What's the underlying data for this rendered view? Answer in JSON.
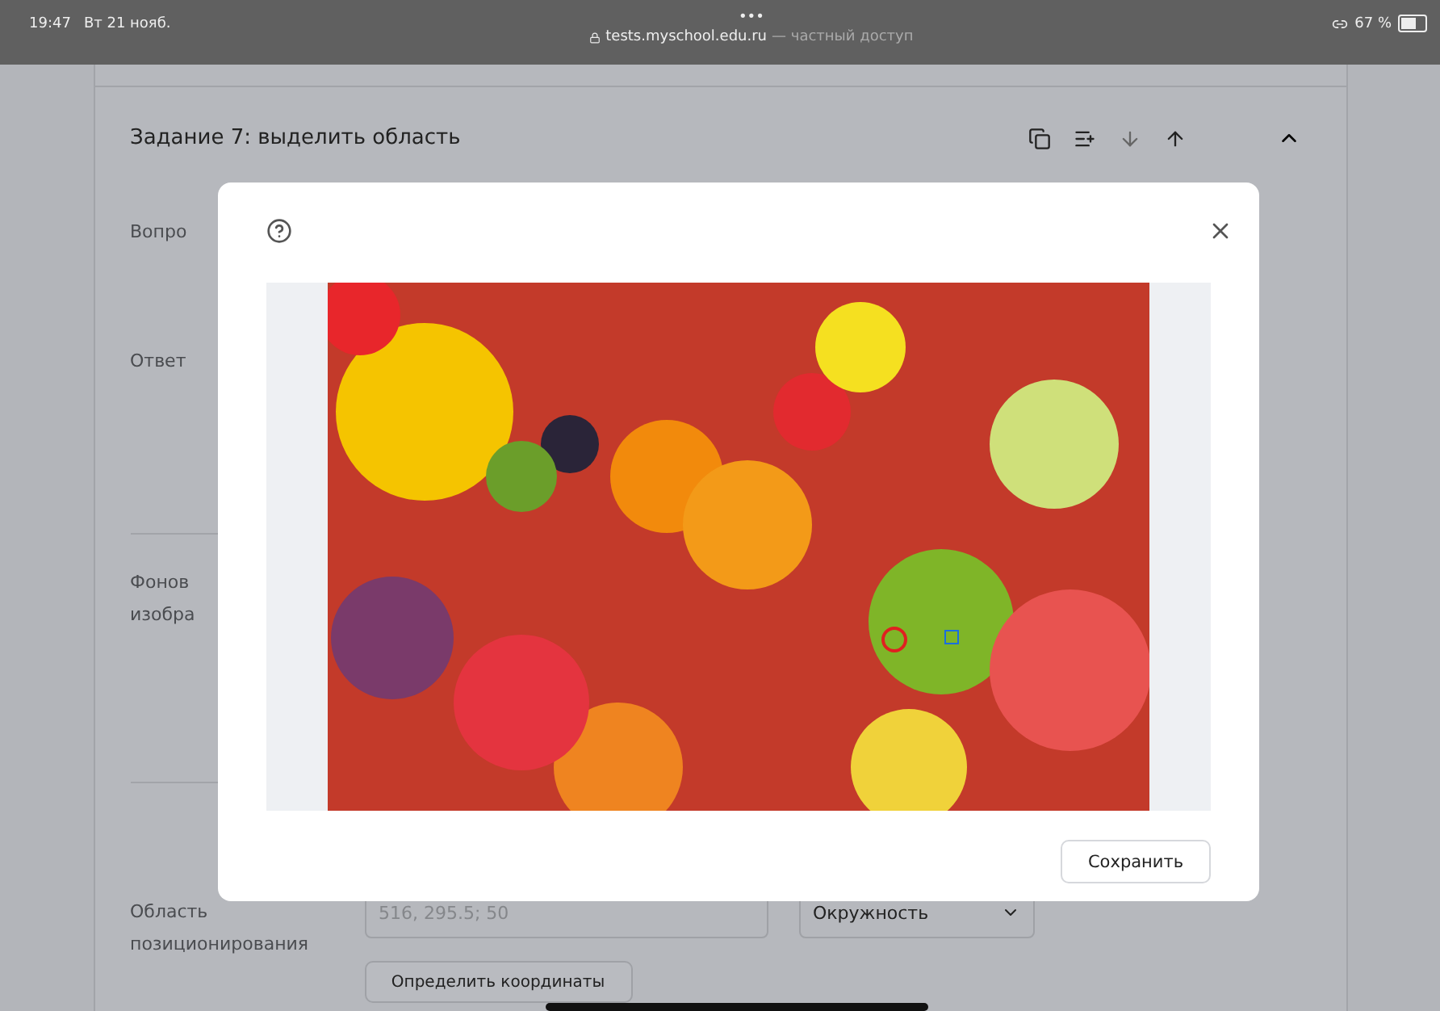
{
  "status_bar": {
    "time": "19:47",
    "date": "Вт 21 нояб.",
    "dots": "•••",
    "url": "tests.myschool.edu.ru",
    "url_note": "— частный доступ",
    "battery": "67 %"
  },
  "task": {
    "title": "Задание 7: выделить область",
    "expanded": true
  },
  "fields": [
    {
      "label": "Вопро"
    },
    {
      "label": "Ответ"
    },
    {
      "label": "Фонов\nизобра"
    }
  ],
  "area": {
    "label": "Область\nпозиционирования",
    "placeholder": "516, 295.5; 50",
    "shape": "Окружность",
    "button": "Определить координаты"
  },
  "modal": {
    "save": "Сохранить",
    "selection": {
      "visible": true
    }
  }
}
